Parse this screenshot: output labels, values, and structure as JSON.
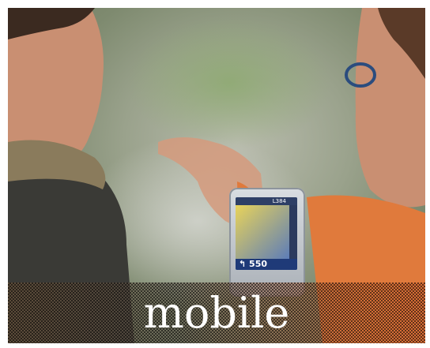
{
  "caption": "mobile",
  "device": {
    "road_label": "L384",
    "distance": "↰ 550"
  },
  "colors": {
    "skin": "#c98f72",
    "jacket_dark": "#3a3a36",
    "jacket_orange": "#e07a3c",
    "background_green": "#8a9a78",
    "caption_text": "#ffffff"
  }
}
